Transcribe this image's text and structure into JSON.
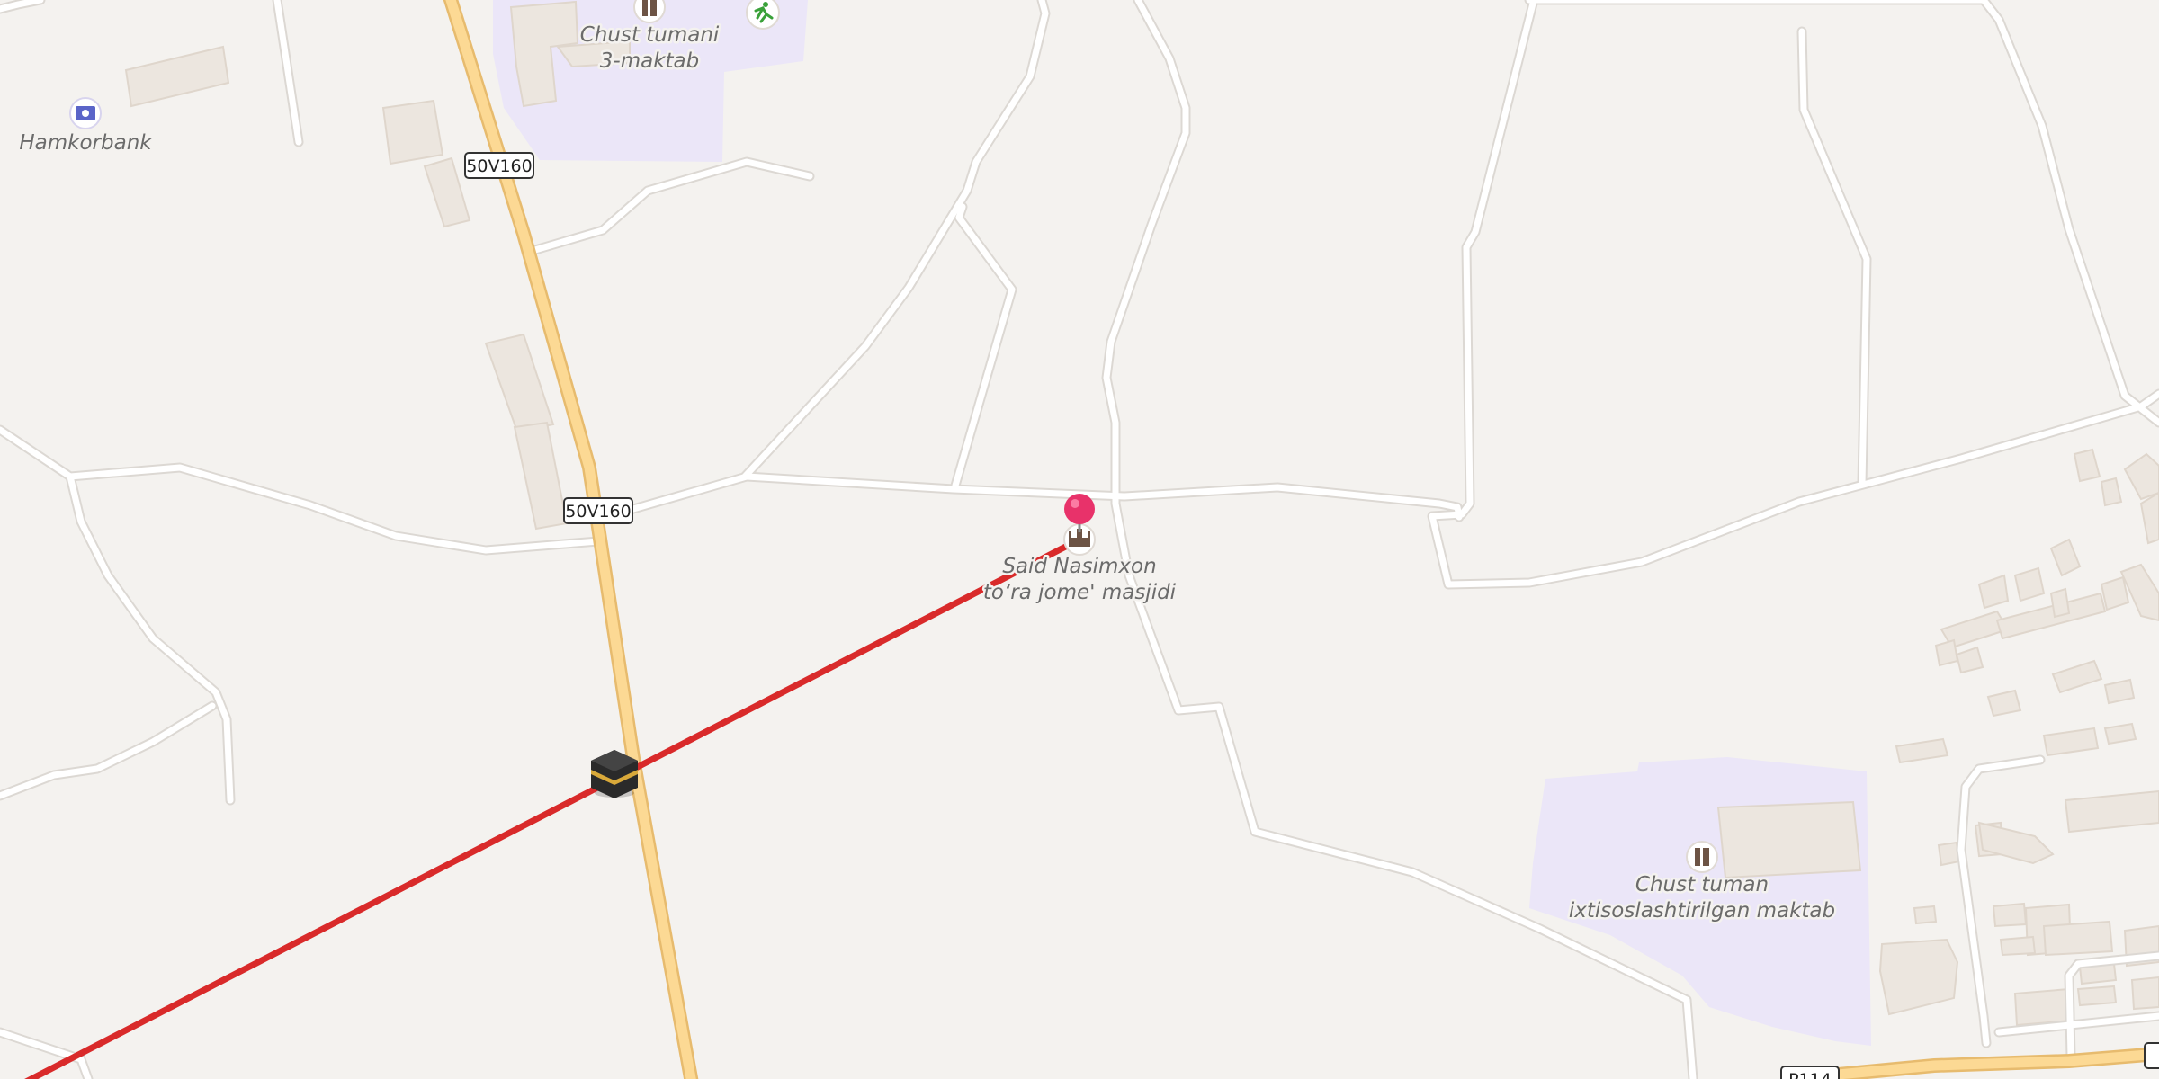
{
  "colors": {
    "background": "#f4f2ef",
    "road_minor": "#ffffff",
    "road_casing": "#dcd8d3",
    "road_primary": "#fcd994",
    "road_primary_casing": "#e7bb6e",
    "school_area": "#ebe6f8",
    "building": "#ece6df",
    "building_edge": "#dfd6cc",
    "qibla_line": "#d92a2a",
    "pin": "#e8326a"
  },
  "pois": [
    {
      "id": "hamkorbank",
      "lines": [
        "Hamkorbank"
      ],
      "icon": "bank-icon"
    },
    {
      "id": "school-3",
      "lines": [
        "Chust tumani",
        "3-maktab"
      ],
      "icon": "school-icon"
    },
    {
      "id": "mosque",
      "lines": [
        "Said Nasimxon",
        "to‘ra jome' masjidi"
      ],
      "icon": "mosque-icon"
    },
    {
      "id": "special-school",
      "lines": [
        "Chust tuman",
        "ixtisoslashtirilgan maktab"
      ],
      "icon": "school-icon"
    },
    {
      "id": "sports",
      "lines": [],
      "icon": "running-icon"
    }
  ],
  "road_shields": [
    "50V160",
    "50V160",
    "P114"
  ],
  "qibla": {
    "icon": "kaaba-icon"
  },
  "selected_pin": {
    "icon": "location-pin-icon"
  }
}
